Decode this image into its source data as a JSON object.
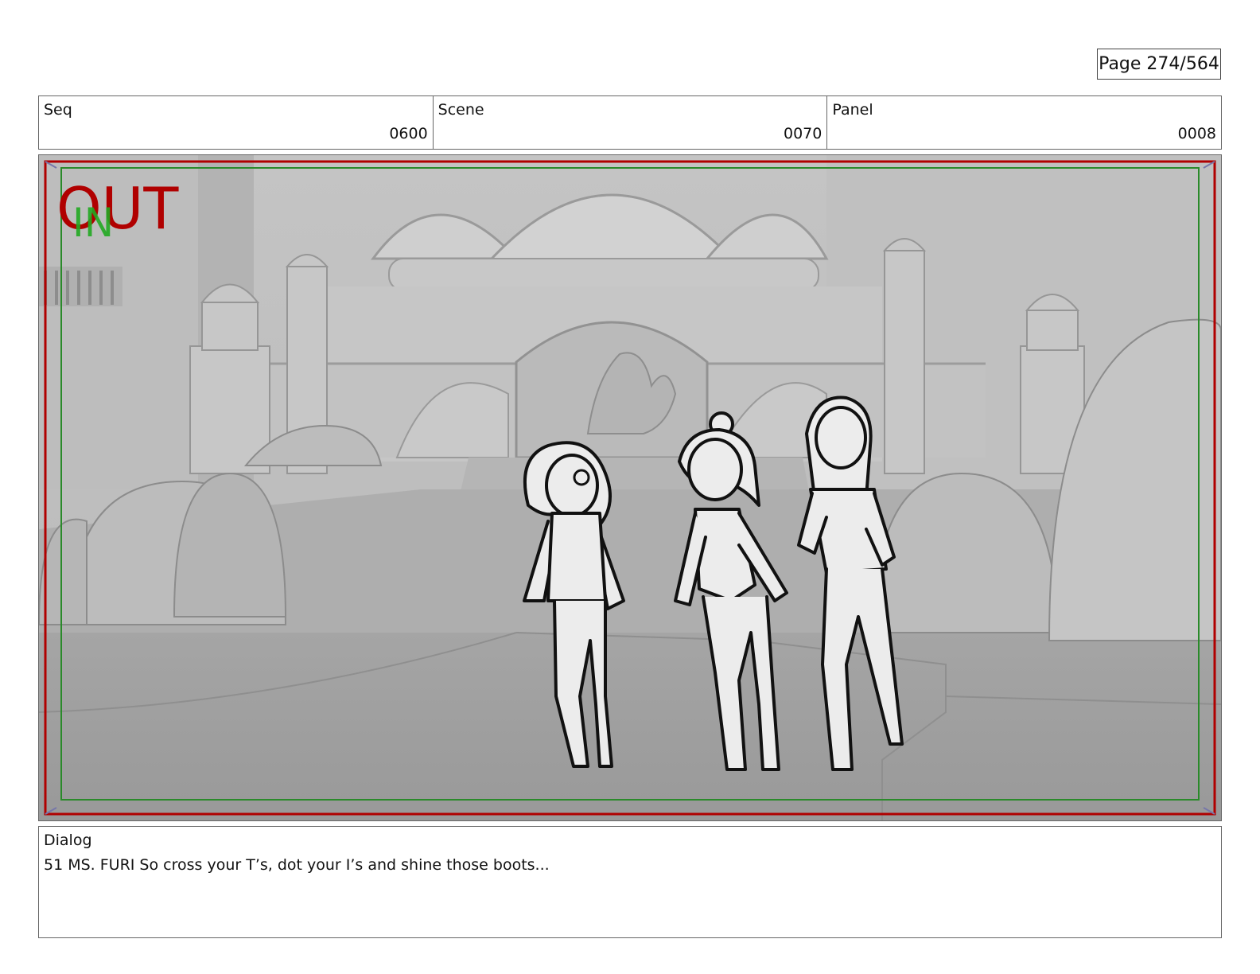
{
  "page": {
    "label": "Page 274/564"
  },
  "header": {
    "seq": {
      "label": "Seq",
      "value": "0600"
    },
    "scene": {
      "label": "Scene",
      "value": "0070"
    },
    "panel": {
      "label": "Panel",
      "value": "0008"
    }
  },
  "frame": {
    "overlay_out": "OUT",
    "overlay_in": "IN",
    "colors": {
      "out": "#b00000",
      "in": "#22aa22",
      "safe_red": "#b00000",
      "safe_green": "#2a8a2a"
    },
    "characters": [
      "girl-curly-hair",
      "girl-bun",
      "girl-long-hair"
    ]
  },
  "dialog": {
    "label": "Dialog",
    "text": "51 MS. FURI So cross your T’s, dot your I’s and shine those boots..."
  }
}
